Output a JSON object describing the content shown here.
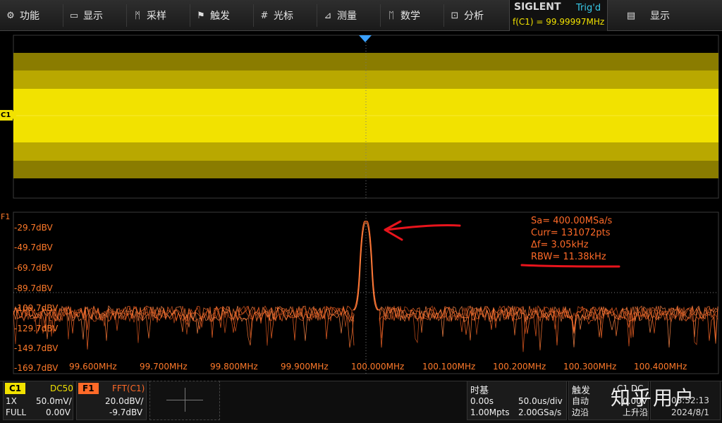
{
  "menu": {
    "items": [
      {
        "label": "功能",
        "icon": "gear-icon",
        "glyph": "⚙"
      },
      {
        "label": "显示",
        "icon": "monitor-icon",
        "glyph": "▭"
      },
      {
        "label": "采样",
        "icon": "sampling-icon",
        "glyph": "ᛗ"
      },
      {
        "label": "触发",
        "icon": "flag-icon",
        "glyph": "⚑"
      },
      {
        "label": "光标",
        "icon": "cursor-grid-icon",
        "glyph": "#"
      },
      {
        "label": "测量",
        "icon": "measure-icon",
        "glyph": "⊿"
      },
      {
        "label": "数学",
        "icon": "math-icon",
        "glyph": "ᛖ"
      },
      {
        "label": "分析",
        "icon": "analysis-icon",
        "glyph": "⊡"
      }
    ],
    "right_item": {
      "label": "显示",
      "icon": "document-icon",
      "glyph": "▤"
    }
  },
  "status": {
    "brand": "SIGLENT",
    "trigger_state": "Trig'd",
    "frequency_counter": "f(C1) = 99.99997MHz"
  },
  "channel_marker": "C1",
  "fft_marker": "F1",
  "fft_axis": {
    "db_labels": [
      "-29.7dBV",
      "-49.7dBV",
      "-69.7dBV",
      "-89.7dBV",
      "-109.7dBV",
      "-129.7dBV",
      "-149.7dBV",
      "-169.7dBV"
    ],
    "freq_labels": [
      "99.600MHz",
      "99.700MHz",
      "99.800MHz",
      "99.900MHz",
      "100.000MHz",
      "100.100MHz",
      "100.200MHz",
      "100.300MHz",
      "100.400MHz"
    ]
  },
  "fft_info": {
    "sa": "Sa=  400.00MSa/s",
    "curr": "Curr= 131072pts",
    "df": "Δf=  3.05kHz",
    "rbw": "RBW=  11.38kHz"
  },
  "channel_box": {
    "tag": "C1",
    "coupling": "DC50",
    "probe": "1X",
    "scale": "50.0mV/",
    "bandwidth": "FULL",
    "offset": "0.00V"
  },
  "fft_box": {
    "tag": "F1",
    "source": "FFT(C1)",
    "scale": "20.0dBV/",
    "ref": "-9.7dBV"
  },
  "timebase": {
    "title": "时基",
    "delay": "0.00s",
    "scale": "50.0us/div",
    "memory": "1.00Mpts",
    "sample_rate": "2.00GSa/s"
  },
  "trigger": {
    "title": "触发",
    "mode": "自动",
    "type": "边沿",
    "channel": "C1 DC",
    "level": "0.00V",
    "slope": "上升沿"
  },
  "clock": {
    "time": "08:52:13",
    "date": "2024/8/1"
  },
  "watermark": "知乎用户",
  "colors": {
    "channel1": "#f2e200",
    "fft": "#ff6a28",
    "trigger_marker": "#3aa0ff",
    "annotation": "#e8141c"
  },
  "fft_peak": {
    "frequency_mhz": 100.0,
    "level_dbv": -29.7
  }
}
